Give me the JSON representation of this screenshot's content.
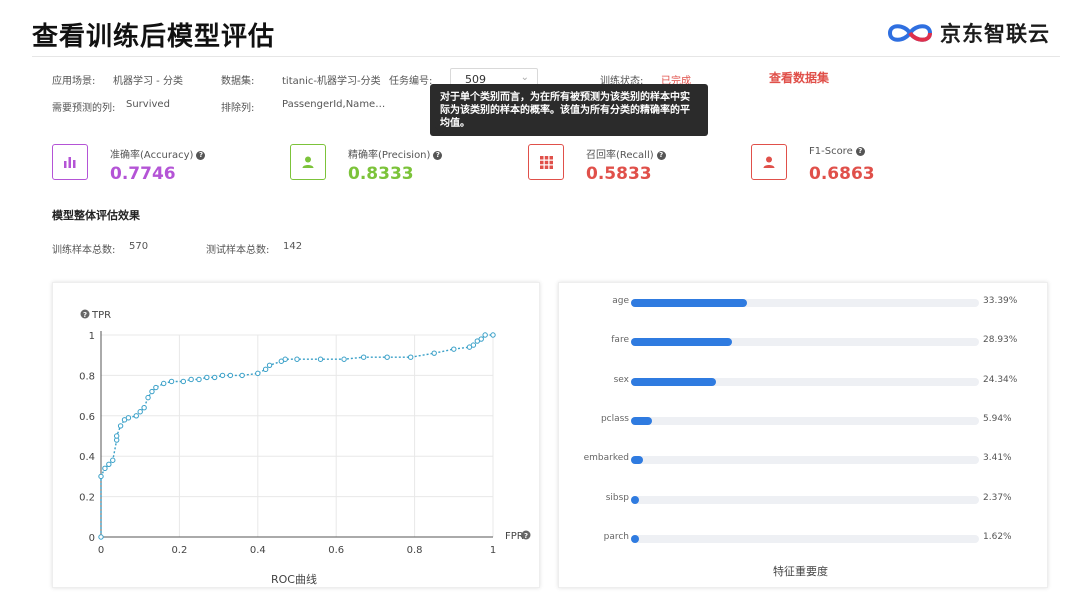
{
  "header": {
    "title": "查看训练后模型评估",
    "brand": "京东智联云"
  },
  "info": {
    "scene_label": "应用场景:",
    "scene_value": "机器学习 - 分类",
    "dataset_label": "数据集:",
    "dataset_value": "titanic-机器学习-分类",
    "task_label": "任务编号:",
    "task_value": "509",
    "status_label": "训练状态:",
    "status_value": "已完成",
    "view_dataset": "查看数据集",
    "predict_col_label": "需要预测的列:",
    "predict_col_value": "Survived",
    "exclude_label": "排除列:",
    "exclude_value": "PassengerId,Name…"
  },
  "tooltip": {
    "line1": "对于单个类别而言，为在所有被预测为该类别的样本中实",
    "line2": "际为该类别的样本的概率。该值为所有分类的精确率的平",
    "line3": "均值。"
  },
  "metrics": [
    {
      "label": "准确率(Accuracy)",
      "value": "0.7746",
      "color": "#b454d6",
      "icon": "bar-chart-icon"
    },
    {
      "label": "精确率(Precision)",
      "value": "0.8333",
      "color": "#7cc33a",
      "icon": "person-icon"
    },
    {
      "label": "召回率(Recall)",
      "value": "0.5833",
      "color": "#e0504a",
      "icon": "grid-icon"
    },
    {
      "label": "F1-Score",
      "value": "0.6863",
      "color": "#e0504a",
      "icon": "person-icon"
    }
  ],
  "overall": {
    "section_title": "模型整体评估效果",
    "train_label": "训练样本总数:",
    "train_value": "570",
    "test_label": "测试样本总数:",
    "test_value": "142"
  },
  "roc": {
    "caption": "ROC曲线",
    "y_label": "TPR",
    "x_label": "FPR",
    "x_ticks": [
      "0",
      "0.2",
      "0.4",
      "0.6",
      "0.8",
      "1"
    ],
    "y_ticks": [
      "0",
      "0.2",
      "0.4",
      "0.6",
      "0.8",
      "1"
    ],
    "line_color": "#3aa0c8"
  },
  "features": {
    "caption": "特征重要度",
    "items": [
      {
        "name": "age",
        "pct": "33.39%",
        "value": 33.39
      },
      {
        "name": "fare",
        "pct": "28.93%",
        "value": 28.93
      },
      {
        "name": "sex",
        "pct": "24.34%",
        "value": 24.34
      },
      {
        "name": "pclass",
        "pct": "5.94%",
        "value": 5.94
      },
      {
        "name": "embarked",
        "pct": "3.41%",
        "value": 3.41
      },
      {
        "name": "sibsp",
        "pct": "2.37%",
        "value": 2.37
      },
      {
        "name": "parch",
        "pct": "1.62%",
        "value": 1.62
      }
    ]
  },
  "chart_data": [
    {
      "type": "line",
      "title": "ROC曲线",
      "xlabel": "FPR",
      "ylabel": "TPR",
      "xlim": [
        0,
        1
      ],
      "ylim": [
        0,
        1
      ],
      "grid": true,
      "series": [
        {
          "x": [
            0,
            0,
            0.01,
            0.02,
            0.03,
            0.04,
            0.04,
            0.05,
            0.06,
            0.07,
            0.09,
            0.1,
            0.11,
            0.12,
            0.13,
            0.14,
            0.16,
            0.18,
            0.21,
            0.23,
            0.25,
            0.27,
            0.29,
            0.31,
            0.33,
            0.36,
            0.4,
            0.42,
            0.43,
            0.46,
            0.47,
            0.5,
            0.56,
            0.62,
            0.67,
            0.73,
            0.79,
            0.85,
            0.9,
            0.94,
            0.95,
            0.96,
            0.97,
            0.98,
            1.0
          ],
          "y": [
            0,
            0.3,
            0.34,
            0.36,
            0.38,
            0.48,
            0.5,
            0.55,
            0.58,
            0.59,
            0.6,
            0.62,
            0.64,
            0.69,
            0.72,
            0.74,
            0.76,
            0.77,
            0.77,
            0.78,
            0.78,
            0.79,
            0.79,
            0.8,
            0.8,
            0.8,
            0.81,
            0.83,
            0.85,
            0.87,
            0.88,
            0.88,
            0.88,
            0.88,
            0.89,
            0.89,
            0.89,
            0.91,
            0.93,
            0.94,
            0.95,
            0.97,
            0.98,
            1.0,
            1.0
          ]
        }
      ]
    },
    {
      "type": "bar",
      "title": "特征重要度",
      "orientation": "horizontal",
      "categories": [
        "age",
        "fare",
        "sex",
        "pclass",
        "embarked",
        "sibsp",
        "parch"
      ],
      "values": [
        33.39,
        28.93,
        24.34,
        5.94,
        3.41,
        2.37,
        1.62
      ],
      "xlim": [
        0,
        100
      ]
    }
  ]
}
